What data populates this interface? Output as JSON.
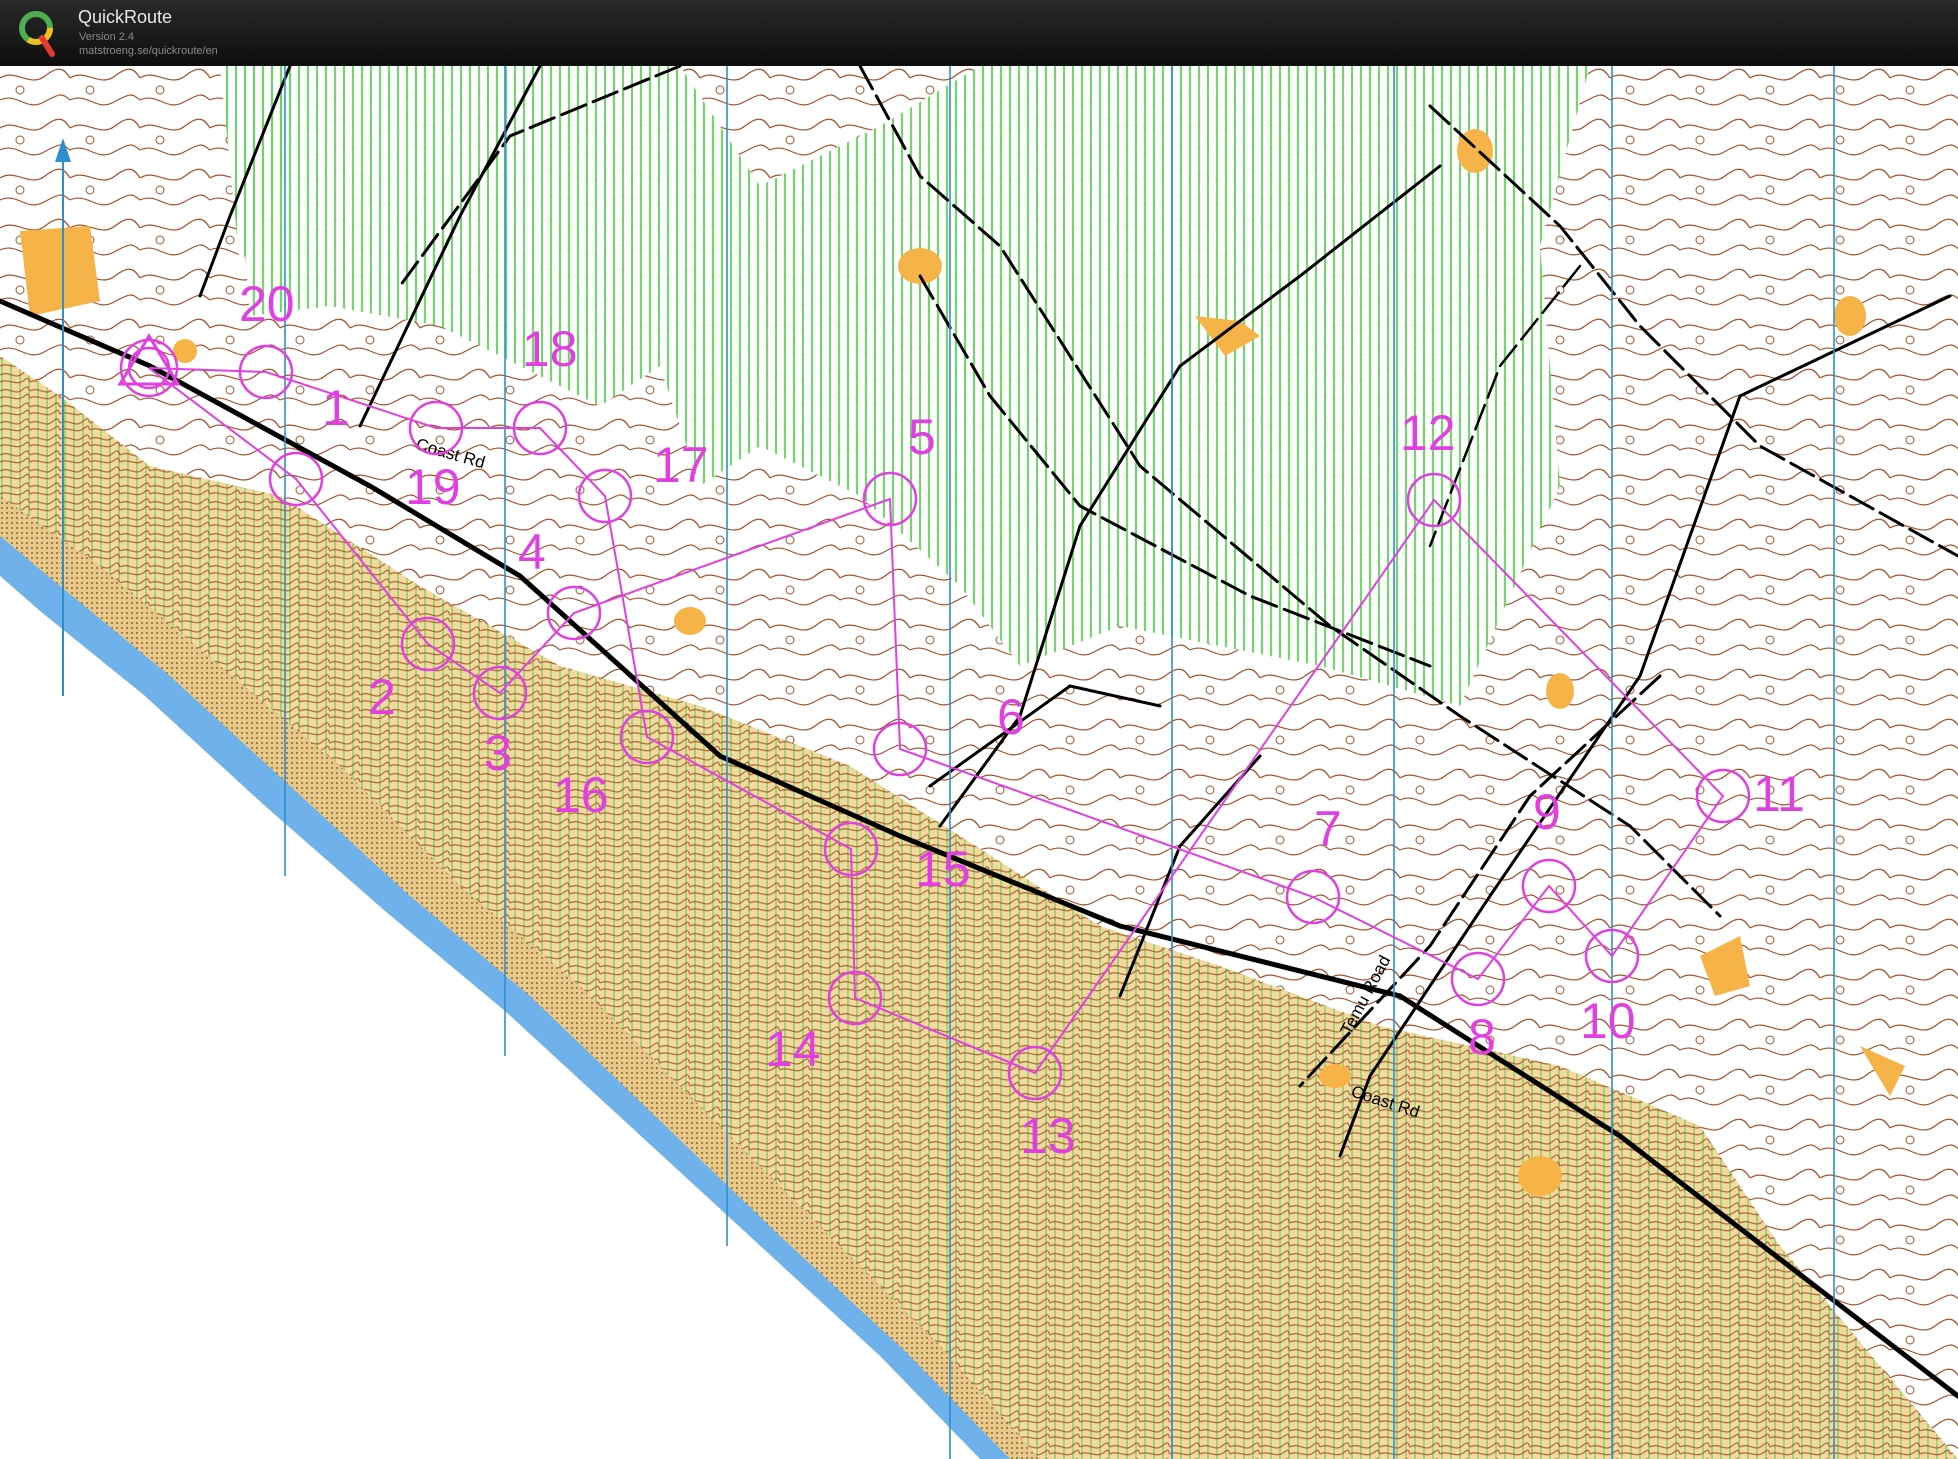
{
  "app": {
    "name": "QuickRoute",
    "version": "Version 2.4",
    "url": "matstroeng.se/quickroute/en"
  },
  "map": {
    "roads": [
      "Coast Rd",
      "Coast Rd",
      "Temu Road"
    ],
    "controls": [
      "1",
      "2",
      "3",
      "4",
      "5",
      "6",
      "7",
      "8",
      "9",
      "10",
      "11",
      "12",
      "13",
      "14",
      "15",
      "16",
      "17",
      "18",
      "19",
      "20"
    ]
  },
  "colors": {
    "course": "#e040e0",
    "sea": "#6fb1ea",
    "vegetation": "#6fd26a",
    "contour": "#9b4a1c",
    "open_land": "#f6b347",
    "rough_open": "#f5dba0",
    "north_line": "#2d8fcf"
  },
  "icons": {
    "logo": "quickroute-logo-icon",
    "north": "north-arrow-icon"
  }
}
